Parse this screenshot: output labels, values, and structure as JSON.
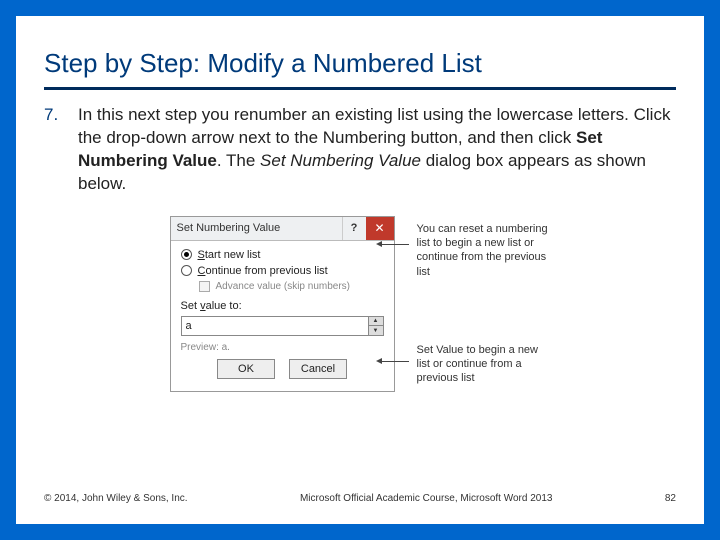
{
  "title": "Step by Step: Modify a Numbered List",
  "step": {
    "number": "7.",
    "text_pre": "In this next step you renumber an existing list using the lowercase letters. Click the drop-down arrow next to the Numbering button, and then click ",
    "bold": "Set Numbering Value",
    "text_mid": ". The ",
    "italic": "Set Numbering Value",
    "text_post": " dialog box appears as shown below."
  },
  "dialog": {
    "title": "Set Numbering Value",
    "help": "?",
    "close": "✕",
    "radio1": "Start new list",
    "radio2": "Continue from previous list",
    "checkbox": "Advance value (skip numbers)",
    "setval_label": "Set value to:",
    "value": "a",
    "preview_label": "Preview: a.",
    "ok": "OK",
    "cancel": "Cancel"
  },
  "callouts": {
    "top": "You can reset a numbering list to begin a new list or continue from the previous list",
    "bottom": "Set Value to begin a new list or continue from a previous list"
  },
  "footer": {
    "left": "© 2014, John Wiley & Sons, Inc.",
    "center": "Microsoft Official Academic Course, Microsoft Word 2013",
    "right": "82"
  }
}
